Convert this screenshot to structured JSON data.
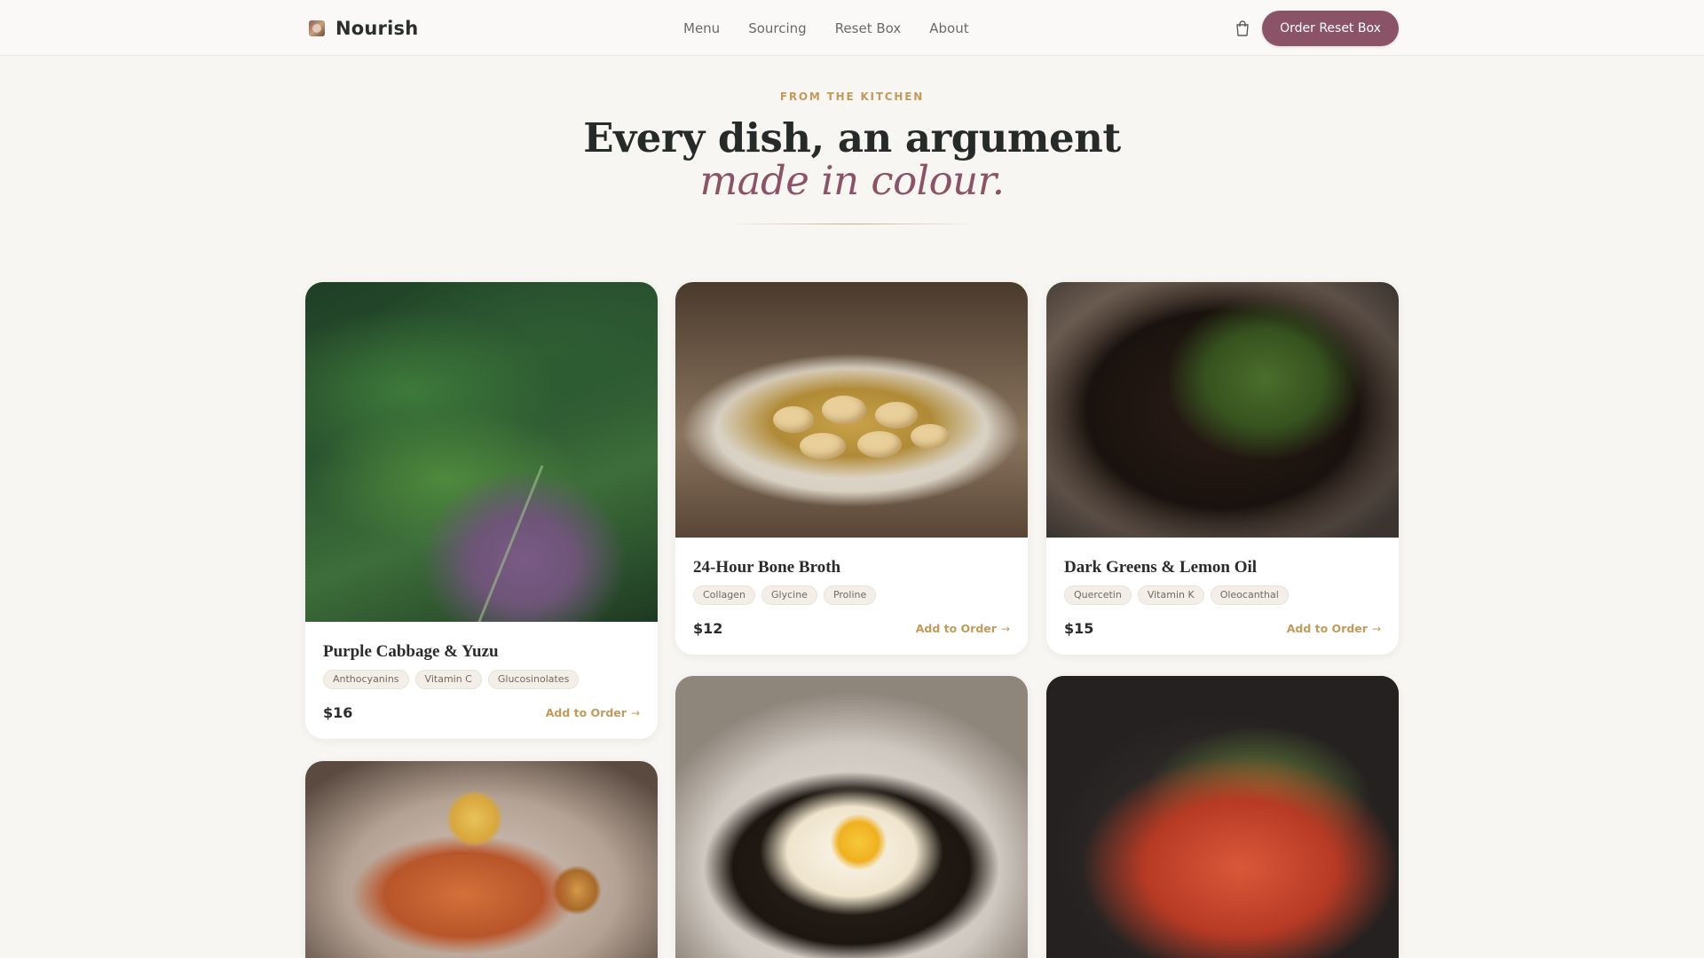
{
  "nav": {
    "brand": "Nourish",
    "brand_icon": "bowl-logo-icon",
    "links": [
      "Menu",
      "Sourcing",
      "Reset Box",
      "About"
    ],
    "cart_icon": "shopping-bag-icon",
    "cta": "Order Reset Box"
  },
  "hero": {
    "eyebrow": "FROM THE KITCHEN",
    "title": "Every dish, an argument",
    "subtitle": "made in colour."
  },
  "colors": {
    "accent": "#8b5368",
    "gold": "#c29a5a",
    "background": "#f8f6f3"
  },
  "dishes": [
    {
      "name": "Purple Cabbage & Yuzu",
      "tags": [
        "Anthocyanins",
        "Vitamin C",
        "Glucosinolates"
      ],
      "price": "$16",
      "action": "Add to Order"
    },
    {
      "name": "24-Hour Bone Broth",
      "tags": [
        "Collagen",
        "Glycine",
        "Proline"
      ],
      "price": "$12",
      "action": "Add to Order"
    },
    {
      "name": "Dark Greens & Lemon Oil",
      "tags": [
        "Quercetin",
        "Vitamin K",
        "Oleocanthal"
      ],
      "price": "$15",
      "action": "Add to Order"
    }
  ],
  "arrow_glyph": "→"
}
